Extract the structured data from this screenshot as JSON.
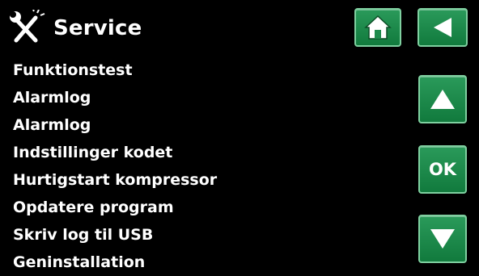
{
  "header": {
    "title": "Service",
    "icon": "tools-icon"
  },
  "menu": {
    "items": [
      "Funktionstest",
      "Alarmlog",
      "Alarmlog",
      "Indstillinger kodet",
      "Hurtigstart kompressor",
      "Opdatere program",
      "Skriv log til USB",
      "Geninstallation"
    ]
  },
  "buttons": {
    "home_icon": "home-icon",
    "back_icon": "back-arrow-icon",
    "up_icon": "up-arrow-icon",
    "ok_label": "OK",
    "down_icon": "down-arrow-icon"
  },
  "colors": {
    "background": "#000000",
    "button_green": "#1e8a4c",
    "text": "#ffffff"
  }
}
